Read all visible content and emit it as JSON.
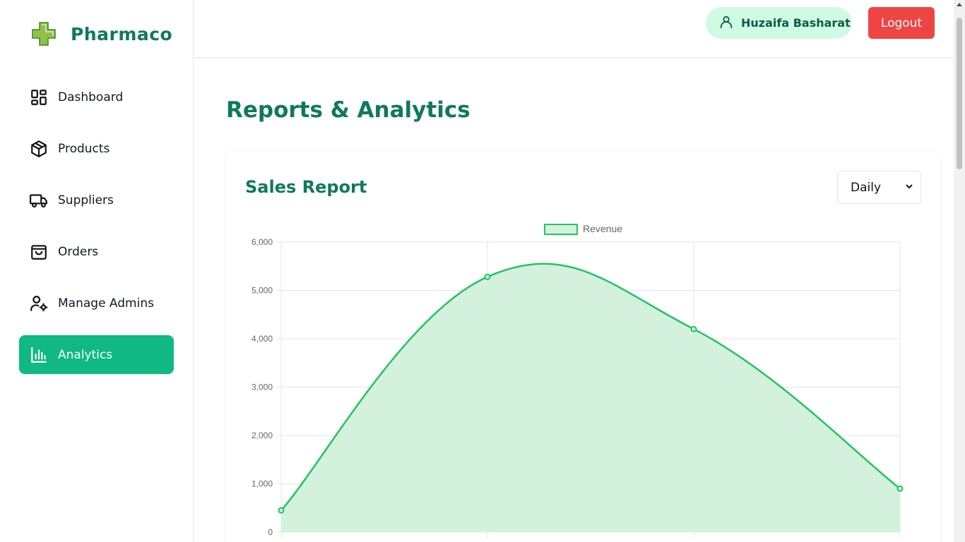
{
  "brand": {
    "name": "Pharmaco"
  },
  "sidebar": {
    "items": [
      {
        "label": "Dashboard",
        "icon": "dashboard-grid-icon"
      },
      {
        "label": "Products",
        "icon": "box-icon"
      },
      {
        "label": "Suppliers",
        "icon": "truck-icon"
      },
      {
        "label": "Orders",
        "icon": "shopping-bag-icon"
      },
      {
        "label": "Manage Admins",
        "icon": "user-cog-icon"
      },
      {
        "label": "Analytics",
        "icon": "bar-chart-icon",
        "active": true
      }
    ]
  },
  "header": {
    "user_name": "Huzaifa Basharat",
    "logout_label": "Logout"
  },
  "main": {
    "title": "Reports & Analytics",
    "card_title": "Sales Report",
    "period_selected": "Daily"
  },
  "colors": {
    "brand": "#0f7a5a",
    "active": "#10b981",
    "logout": "#ef4444",
    "user_chip": "#d1fae5",
    "series_line": "#22c55e",
    "series_fill": "#d4f1de"
  },
  "chart_data": {
    "type": "area",
    "series": [
      {
        "name": "Revenue",
        "values": [
          450,
          5280,
          4200,
          900
        ]
      }
    ],
    "ylim": [
      0,
      6000
    ],
    "y_ticks": [
      "6,000",
      "5,000",
      "4,000",
      "3,000",
      "2,000",
      "1,000",
      "0"
    ],
    "grid": true,
    "legend": "top-center"
  }
}
